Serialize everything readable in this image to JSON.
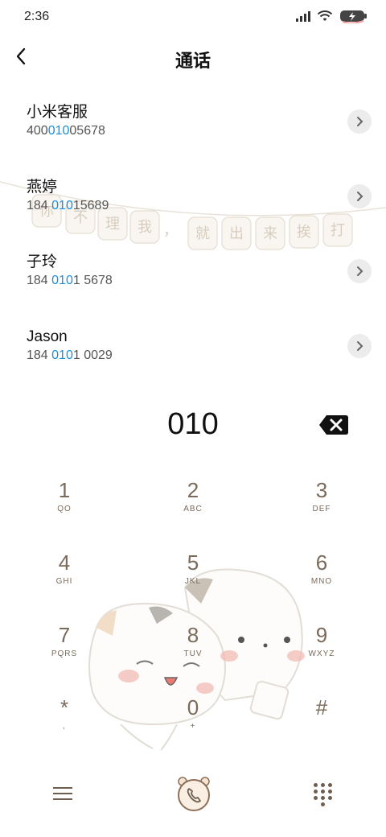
{
  "status_bar": {
    "time": "2:36",
    "signal_icon": "cellular-signal-icon",
    "wifi_icon": "wifi-icon",
    "battery_icon": "battery-charging-icon"
  },
  "header": {
    "title": "通话",
    "back_icon": "chevron-left-icon"
  },
  "contacts": [
    {
      "name": "小米客服",
      "number_before": "400",
      "number_match": "010",
      "number_after": "05678"
    },
    {
      "name": "燕婷",
      "number_before": "184 ",
      "number_match": "010",
      "number_after": "15689"
    },
    {
      "name": "子玲",
      "number_before": "184 ",
      "number_match": "010",
      "number_after": "1 5678"
    },
    {
      "name": "Jason",
      "number_before": "184 ",
      "number_match": "010",
      "number_after": "1 0029"
    }
  ],
  "banner": {
    "chars": [
      "你",
      "不",
      "理",
      "我",
      "，",
      "就",
      "出",
      "来",
      "挨",
      "打"
    ]
  },
  "dialer": {
    "value": "010",
    "delete_icon": "backspace-icon"
  },
  "keypad": [
    {
      "digit": "1",
      "letters": "QO"
    },
    {
      "digit": "2",
      "letters": "ABC"
    },
    {
      "digit": "3",
      "letters": "DEF"
    },
    {
      "digit": "4",
      "letters": "GHI"
    },
    {
      "digit": "5",
      "letters": "JKL"
    },
    {
      "digit": "6",
      "letters": "MNO"
    },
    {
      "digit": "7",
      "letters": "PQRS"
    },
    {
      "digit": "8",
      "letters": "TUV"
    },
    {
      "digit": "9",
      "letters": "WXYZ"
    },
    {
      "digit": "*",
      "letters": ","
    },
    {
      "digit": "0",
      "letters": "+"
    },
    {
      "digit": "#",
      "letters": ""
    }
  ],
  "bottom_bar": {
    "menu_icon": "menu-icon",
    "call_icon": "phone-call-icon",
    "keypad_icon": "dialpad-icon"
  },
  "colors": {
    "highlight": "#1a8ee0",
    "key_text": "#7a6a5a",
    "accent_brown": "#6d5e50"
  }
}
